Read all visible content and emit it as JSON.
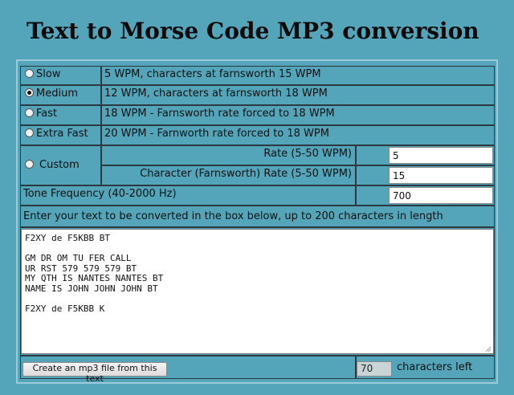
{
  "header": {
    "title": "Text to Morse Code MP3 conversion"
  },
  "speeds": [
    {
      "label": "Slow",
      "description": "5 WPM, characters at farnsworth 15 WPM",
      "selected": false
    },
    {
      "label": "Medium",
      "description": "12 WPM, characters at farnsworth 18 WPM",
      "selected": true
    },
    {
      "label": "Fast",
      "description": "18 WPM - Farnsworth rate forced to 18 WPM",
      "selected": false
    },
    {
      "label": "Extra Fast",
      "description": "20 WPM - Farnworth rate forced to 18 WPM",
      "selected": false
    },
    {
      "label": "Custom",
      "selected": false
    }
  ],
  "custom": {
    "rate_label": "Rate (5-50 WPM)",
    "rate_value": "5",
    "char_rate_label": "Character (Farnsworth) Rate (5-50 WPM)",
    "char_rate_value": "15"
  },
  "tone": {
    "label": "Tone Frequency (40-2000 Hz)",
    "value": "700"
  },
  "text_section": {
    "instructions": "Enter your text to be converted in the box below, up to 200 characters in length",
    "content": "F2XY de F5KBB BT\n\nGM DR OM TU FER CALL\nUR RST 579 579 579 BT\nMY QTH IS NANTES NANTES BT\nNAME IS JOHN JOHN JOHN BT\n\nF2XY de F5KBB K"
  },
  "footer": {
    "create_button": "Create an mp3 file from this text",
    "chars_left_value": "70",
    "chars_left_label": "characters left"
  }
}
